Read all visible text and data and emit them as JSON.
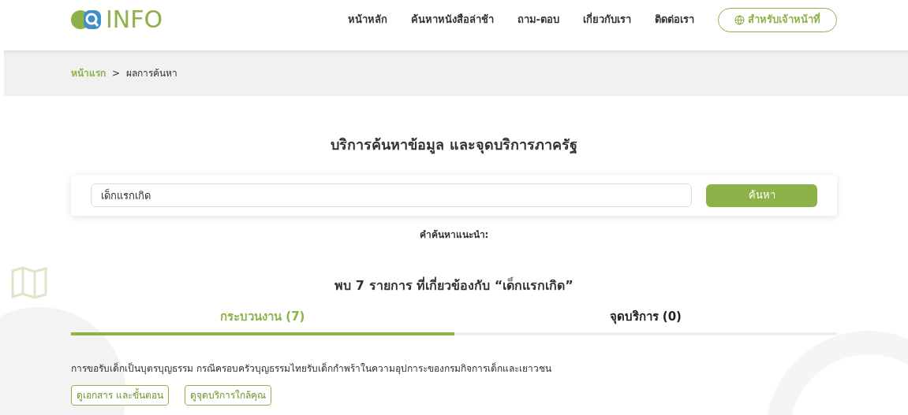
{
  "logo": {
    "text": "INFO"
  },
  "nav": {
    "items": [
      "หน้าหลัก",
      "ค้นหาหนังสือล่าช้า",
      "ถาม-ตอบ",
      "เกี่ยวกับเรา",
      "ติดต่อเรา"
    ],
    "staff_button": "สำหรับเจ้าหน้าที่"
  },
  "breadcrumb": {
    "home": "หน้าแรก",
    "separator": ">",
    "current": "ผลการค้นหา"
  },
  "heading": "บริการค้นหาข้อมูล และจุดบริการภาครัฐ",
  "search": {
    "value": "เด็กแรกเกิด",
    "button": "ค้นหา"
  },
  "suggestions_label": "คำค้นหาแนะนำ:",
  "result_summary": "พบ 7 รายการ ที่เกี่ยวข้องกับ “เด็กแรกเกิด”",
  "tabs": [
    {
      "label": "กระบวนงาน (7)",
      "selected": true
    },
    {
      "label": "จุดบริการ (0)",
      "selected": false
    }
  ],
  "results": [
    {
      "title": "การขอรับเด็กเป็นบุตรบุญธรรม กรณีครอบครัวบุญธรรมไทยรับเด็กกำพร้าในความอุปการะของกรมกิจการเด็กและเยาวชน",
      "actions": [
        "ดูเอกสาร และขั้นตอน",
        "ดูจุดบริการใกล้คุณ"
      ]
    }
  ]
}
